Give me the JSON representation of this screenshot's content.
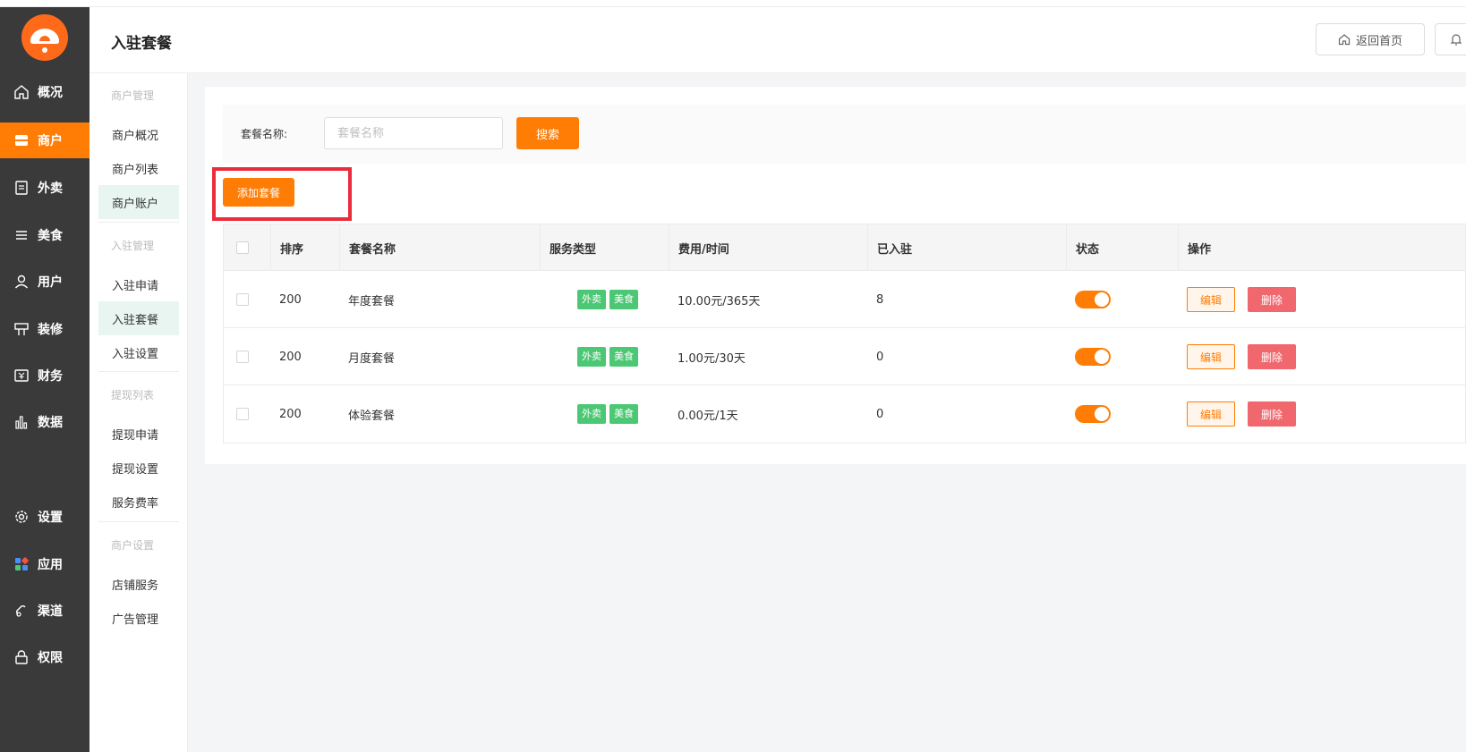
{
  "header": {
    "title": "入驻套餐",
    "home_label": "返回首页"
  },
  "nav": {
    "items": [
      {
        "label": "概况",
        "icon": "home-icon"
      },
      {
        "label": "商户",
        "icon": "store-icon"
      },
      {
        "label": "外卖",
        "icon": "document-icon"
      },
      {
        "label": "美食",
        "icon": "menu-icon"
      },
      {
        "label": "用户",
        "icon": "user-icon"
      },
      {
        "label": "装修",
        "icon": "decorate-icon"
      },
      {
        "label": "财务",
        "icon": "finance-icon"
      },
      {
        "label": "数据",
        "icon": "chart-icon"
      },
      {
        "label": "设置",
        "icon": "gear-icon"
      },
      {
        "label": "应用",
        "icon": "apps-icon"
      },
      {
        "label": "渠道",
        "icon": "link-icon"
      },
      {
        "label": "权限",
        "icon": "lock-icon"
      }
    ],
    "active": "商户",
    "accent": "#ff7d05"
  },
  "subnav": {
    "groups": [
      {
        "title": "商户管理",
        "items": [
          "商户概况",
          "商户列表",
          "商户账户"
        ]
      },
      {
        "title": "入驻管理",
        "items": [
          "入驻申请",
          "入驻套餐",
          "入驻设置"
        ]
      },
      {
        "title": "提现列表",
        "items": [
          "提现申请",
          "提现设置",
          "服务费率"
        ]
      },
      {
        "title": "商户设置",
        "items": [
          "店铺服务",
          "广告管理"
        ]
      }
    ]
  },
  "filter": {
    "label": "套餐名称:",
    "placeholder": "套餐名称",
    "value": "",
    "search_label": "搜索"
  },
  "add_button": "添加套餐",
  "table": {
    "columns": [
      "排序",
      "套餐名称",
      "服务类型",
      "费用/时间",
      "已入驻",
      "状态",
      "操作"
    ],
    "rows": [
      {
        "sort": "200",
        "name": "年度套餐",
        "tags": [
          "外卖",
          "美食"
        ],
        "fee": "10.00元/365天",
        "joined": "8",
        "enabled": true
      },
      {
        "sort": "200",
        "name": "月度套餐",
        "tags": [
          "外卖",
          "美食"
        ],
        "fee": "1.00元/30天",
        "joined": "0",
        "enabled": true
      },
      {
        "sort": "200",
        "name": "体验套餐",
        "tags": [
          "外卖",
          "美食"
        ],
        "fee": "0.00元/1天",
        "joined": "0",
        "enabled": true
      }
    ],
    "edit_label": "编辑",
    "delete_label": "删除"
  },
  "colors": {
    "primary": "#ff7d05",
    "tag": "#4cc774",
    "danger": "#f0676e",
    "highlight_frame": "#ea2c3c"
  }
}
